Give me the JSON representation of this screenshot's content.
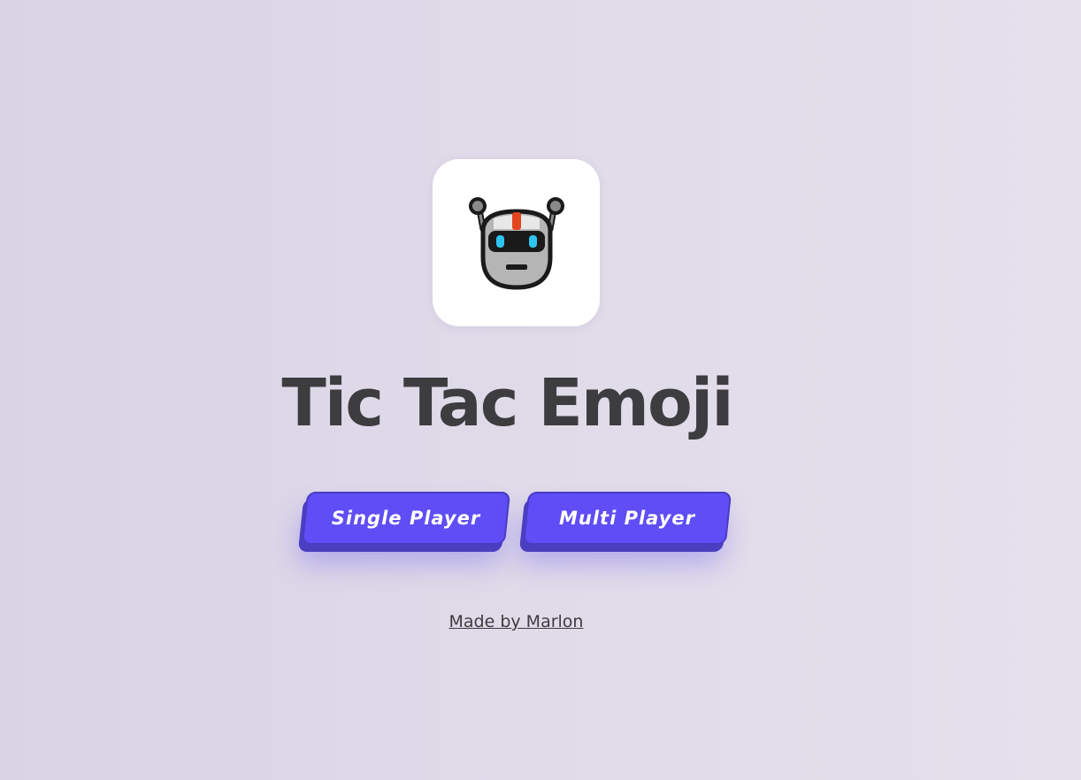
{
  "logo": {
    "icon": "robot-face-icon"
  },
  "title": "Tic Tac Emoji",
  "buttons": {
    "single_player": "Single Player",
    "multi_player": "Multi Player"
  },
  "footer": {
    "credit_link": "Made by Marlon"
  },
  "colors": {
    "background": "#dfdae8",
    "button_face": "#5f4df5",
    "button_edge": "#4b3fc0",
    "title_text": "#3d3c3f"
  }
}
